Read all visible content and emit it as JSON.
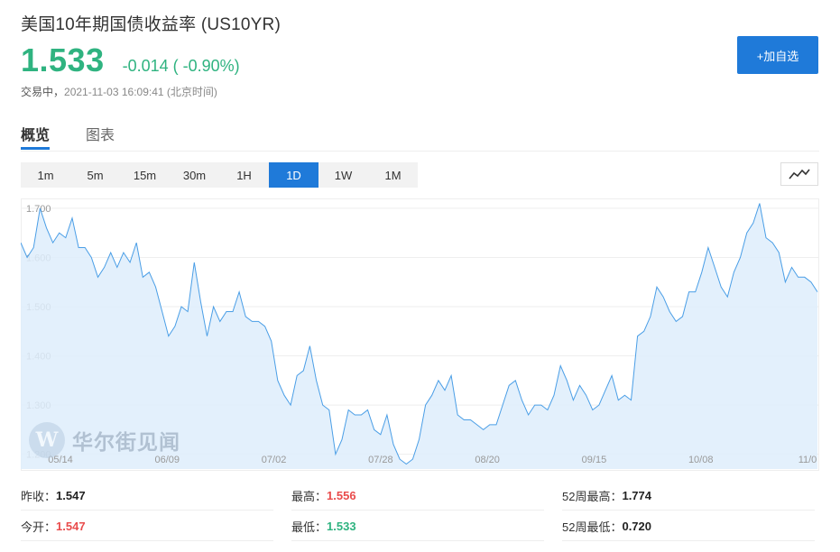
{
  "header": {
    "title": "美国10年期国债收益率 (US10YR)",
    "price": "1.533",
    "change": "-0.014 ( -0.90%)",
    "status": "交易中",
    "timestamp": "2021-11-03 16:09:41 (北京时间)",
    "add_button": "+加自选"
  },
  "tabs": [
    {
      "label": "概览",
      "active": true
    },
    {
      "label": "图表",
      "active": false
    }
  ],
  "ranges": [
    {
      "label": "1m",
      "active": false
    },
    {
      "label": "5m",
      "active": false
    },
    {
      "label": "15m",
      "active": false
    },
    {
      "label": "30m",
      "active": false
    },
    {
      "label": "1H",
      "active": false
    },
    {
      "label": "1D",
      "active": true
    },
    {
      "label": "1W",
      "active": false
    },
    {
      "label": "1M",
      "active": false
    }
  ],
  "watermark": {
    "logo_letter": "W",
    "text": "华尔街见闻"
  },
  "stats": [
    [
      {
        "label": "昨收：",
        "value": "1.547",
        "tone": "neutral"
      },
      {
        "label": "最高：",
        "value": "1.556",
        "tone": "up"
      },
      {
        "label": "52周最高：",
        "value": "1.774",
        "tone": "neutral"
      }
    ],
    [
      {
        "label": "今开：",
        "value": "1.547",
        "tone": "up"
      },
      {
        "label": "最低：",
        "value": "1.533",
        "tone": "down"
      },
      {
        "label": "52周最低：",
        "value": "0.720",
        "tone": "neutral"
      }
    ]
  ],
  "colors": {
    "line": "#4a9ee6",
    "fill": "#deedfb",
    "accent": "#1f7ad9",
    "up": "#e94c4c",
    "down": "#2fb380"
  },
  "chart_data": {
    "type": "area",
    "ylim": [
      1.17,
      1.72
    ],
    "y_ticks": [
      "1.700",
      "1.600",
      "1.500",
      "1.400",
      "1.300",
      "1.200"
    ],
    "x_ticks": [
      "05/14",
      "06/09",
      "07/02",
      "07/28",
      "08/20",
      "09/15",
      "10/08",
      "11/0"
    ],
    "grid": true,
    "values": [
      1.63,
      1.6,
      1.62,
      1.7,
      1.66,
      1.63,
      1.65,
      1.64,
      1.68,
      1.62,
      1.62,
      1.6,
      1.56,
      1.58,
      1.61,
      1.58,
      1.61,
      1.59,
      1.63,
      1.56,
      1.57,
      1.54,
      1.49,
      1.44,
      1.46,
      1.5,
      1.49,
      1.59,
      1.51,
      1.44,
      1.5,
      1.47,
      1.49,
      1.49,
      1.53,
      1.48,
      1.47,
      1.47,
      1.46,
      1.43,
      1.35,
      1.32,
      1.3,
      1.36,
      1.37,
      1.42,
      1.35,
      1.3,
      1.29,
      1.2,
      1.23,
      1.29,
      1.28,
      1.28,
      1.29,
      1.25,
      1.24,
      1.28,
      1.22,
      1.19,
      1.18,
      1.19,
      1.23,
      1.3,
      1.32,
      1.35,
      1.33,
      1.36,
      1.28,
      1.27,
      1.27,
      1.26,
      1.25,
      1.26,
      1.26,
      1.3,
      1.34,
      1.35,
      1.31,
      1.28,
      1.3,
      1.3,
      1.29,
      1.32,
      1.38,
      1.35,
      1.31,
      1.34,
      1.32,
      1.29,
      1.3,
      1.33,
      1.36,
      1.31,
      1.32,
      1.31,
      1.44,
      1.45,
      1.48,
      1.54,
      1.52,
      1.49,
      1.47,
      1.48,
      1.53,
      1.53,
      1.57,
      1.62,
      1.58,
      1.54,
      1.52,
      1.57,
      1.6,
      1.65,
      1.67,
      1.71,
      1.64,
      1.63,
      1.61,
      1.55,
      1.58,
      1.56,
      1.56,
      1.55,
      1.53
    ]
  }
}
